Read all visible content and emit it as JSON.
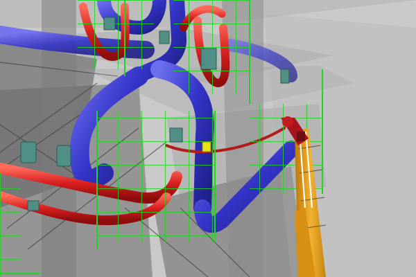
{
  "scene": {
    "kind": "3d-plant-model-render",
    "elements": [
      "steel-structure",
      "translucent-floor-slabs",
      "blue-pipe-loop",
      "red-pipe-runs",
      "green-scaffolding",
      "teal-pipe-supports",
      "crawler-crane-boom",
      "crane-hook-block"
    ]
  },
  "colors": {
    "background": "#c9c9c9",
    "structure": "#8e8e8e",
    "slab": "#9a9a9a",
    "blue_pipe": "#3a3ad2",
    "red_pipe": "#d81f1f",
    "scaffold": "#21d421",
    "support": "#4f8f86",
    "crane_boom": "#e8a01c",
    "crane_head": "#a8141c"
  }
}
